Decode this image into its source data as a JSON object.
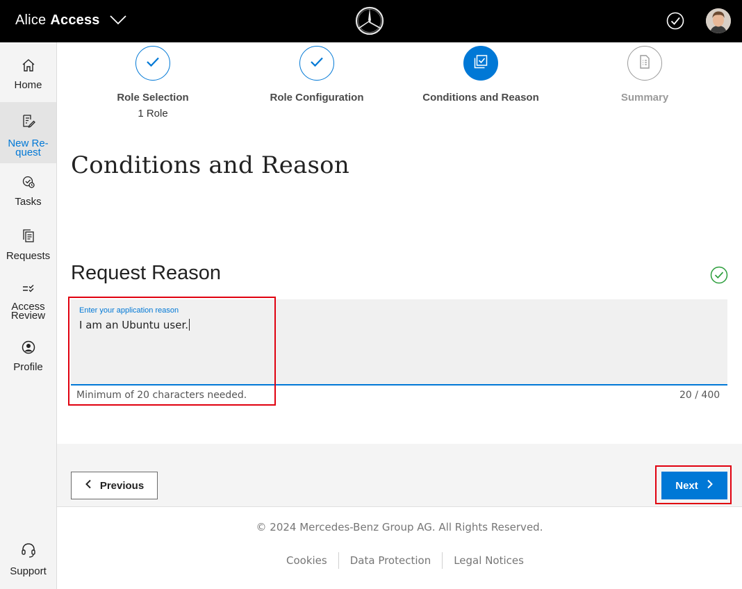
{
  "header": {
    "app_name_light": "Alice",
    "app_name_bold": "Access"
  },
  "sidebar": {
    "items": [
      {
        "label": "Home"
      },
      {
        "label_line1": "New Re-",
        "label_line2": "quest"
      },
      {
        "label": "Tasks"
      },
      {
        "label": "Requests"
      },
      {
        "label_line1": "Access",
        "label_line2": "Review"
      },
      {
        "label": "Profile"
      },
      {
        "label": "Support"
      }
    ]
  },
  "stepper": {
    "steps": [
      {
        "label": "Role Selection",
        "sub": "1 Role",
        "state": "completed"
      },
      {
        "label": "Role Configuration",
        "state": "completed"
      },
      {
        "label": "Conditions and Reason",
        "state": "current"
      },
      {
        "label": "Summary",
        "state": "pending"
      }
    ]
  },
  "page": {
    "title": "Conditions and Reason"
  },
  "reason": {
    "section_title": "Request Reason",
    "field_label": "Enter your application reason",
    "field_value": "I am an Ubuntu user.",
    "helper_text": "Minimum of 20 characters needed.",
    "counter": "20 / 400"
  },
  "actions": {
    "previous_label": "Previous",
    "next_label": "Next"
  },
  "footer": {
    "copyright": "© 2024 Mercedes-Benz Group AG. All Rights Reserved.",
    "links": [
      "Cookies",
      "Data Protection",
      "Legal Notices"
    ]
  },
  "colors": {
    "accent": "#0078d6",
    "header_bg": "#000000",
    "highlight": "#e0000f",
    "valid": "#2a9d3a"
  }
}
